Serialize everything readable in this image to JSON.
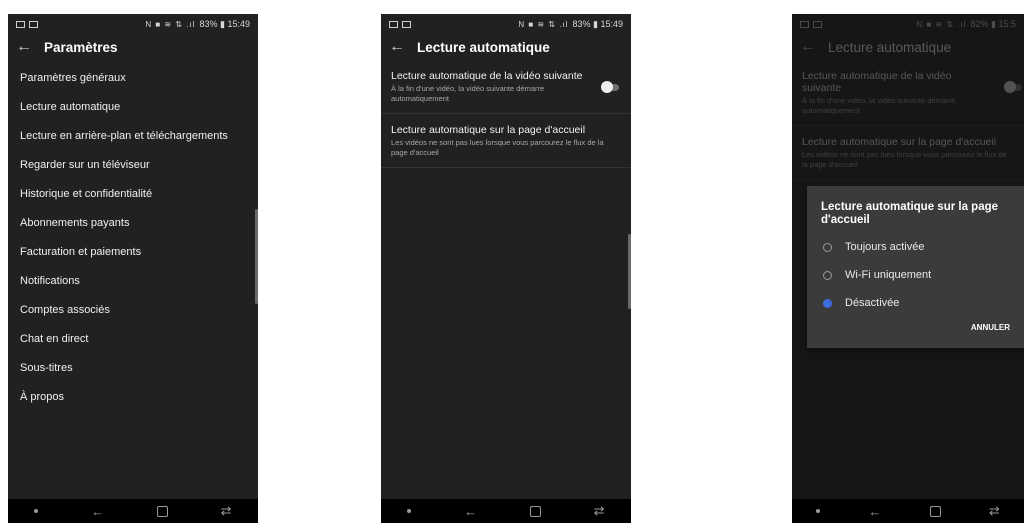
{
  "status_bar": {
    "screen1_battery_text": "83% ▮ 15:49",
    "screen2_battery_text": "83% ▮ 15:49",
    "screen3_battery_text": "82% ▮ 15:5",
    "glyphs": "N ■ ≋ ⇅ .ıl"
  },
  "screen1": {
    "title": "Paramètres",
    "items": [
      "Paramètres généraux",
      "Lecture automatique",
      "Lecture en arrière-plan et téléchargements",
      "Regarder sur un téléviseur",
      "Historique et confidentialité",
      "Abonnements payants",
      "Facturation et paiements",
      "Notifications",
      "Comptes associés",
      "Chat en direct",
      "Sous-titres",
      "À propos"
    ]
  },
  "screen2": {
    "title": "Lecture automatique",
    "next_video_title": "Lecture automatique de la vidéo suivante",
    "next_video_desc": "À la fin d'une vidéo, la vidéo suivante démarre automatiquement",
    "next_video_enabled": false,
    "home_title": "Lecture automatique sur la page d'accueil",
    "home_desc": "Les vidéos ne sont pas lues lorsque vous parcourez le flux de la page d'accueil"
  },
  "screen3": {
    "title": "Lecture automatique",
    "dialog": {
      "title": "Lecture automatique sur la page d'accueil",
      "options": [
        "Toujours activée",
        "Wi-Fi uniquement",
        "Désactivée"
      ],
      "selected_index": 2,
      "cancel_label": "ANNULER"
    }
  },
  "icons": {
    "back": "arrow-left",
    "nav_back": "back",
    "nav_home": "home",
    "nav_recent": "recent-apps"
  },
  "colors": {
    "accent": "#3e6ce0",
    "background": "#212121",
    "dialog": "#3b3b3b"
  }
}
